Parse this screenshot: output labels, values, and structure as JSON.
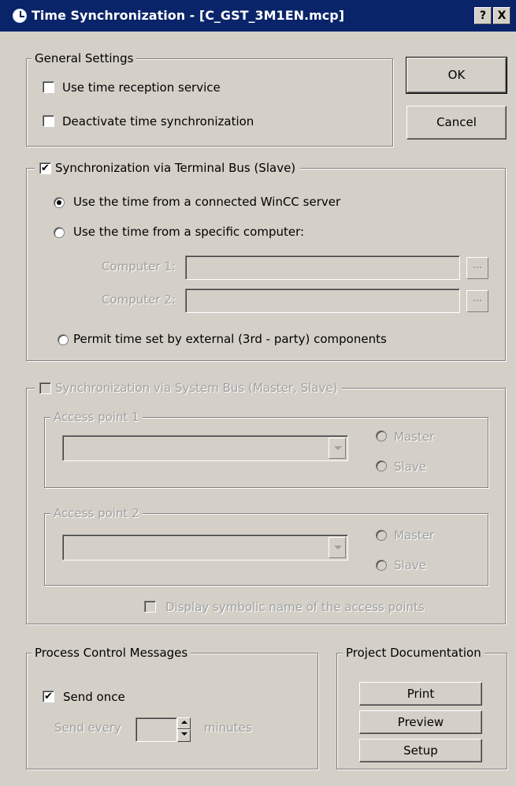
{
  "window": {
    "title": "Time Synchronization - [C_GST_3M1EN.mcp]",
    "help_label": "?",
    "close_label": "X"
  },
  "general": {
    "label": "General Settings",
    "use_time_reception": {
      "label": "Use time reception service",
      "checked": false
    },
    "deactivate": {
      "label": "Deactivate time synchronization",
      "checked": false
    }
  },
  "buttons": {
    "ok": "OK",
    "cancel": "Cancel"
  },
  "terminal_bus": {
    "label": "Synchronization via Terminal Bus (Slave)",
    "checked": true,
    "options": [
      {
        "label": "Use the time from a connected WinCC server",
        "selected": true
      },
      {
        "label": "Use the time from a specific computer:",
        "selected": false
      },
      {
        "label": "Permit time set by external (3rd - party) components",
        "selected": false
      }
    ],
    "computer1_label": "Computer 1:",
    "computer2_label": "Computer 2:",
    "computer1_value": "",
    "computer2_value": "",
    "browse_label": "..."
  },
  "system_bus": {
    "label": "Synchronization via System Bus (Master, Slave)",
    "checked": false,
    "access_point_1": {
      "label": "Access point 1",
      "master": "Master",
      "slave": "Slave",
      "value": ""
    },
    "access_point_2": {
      "label": "Access point 2",
      "master": "Master",
      "slave": "Slave",
      "value": ""
    },
    "symbolic_name": {
      "label": "Display symbolic name of the access points",
      "checked": false
    }
  },
  "process_control": {
    "label": "Process Control Messages",
    "send_once": {
      "label": "Send once",
      "checked": true
    },
    "send_every_label": "Send every",
    "send_every_value": "",
    "minutes_label": "minutes"
  },
  "project_doc": {
    "label": "Project Documentation",
    "print": "Print",
    "preview": "Preview",
    "setup": "Setup"
  }
}
